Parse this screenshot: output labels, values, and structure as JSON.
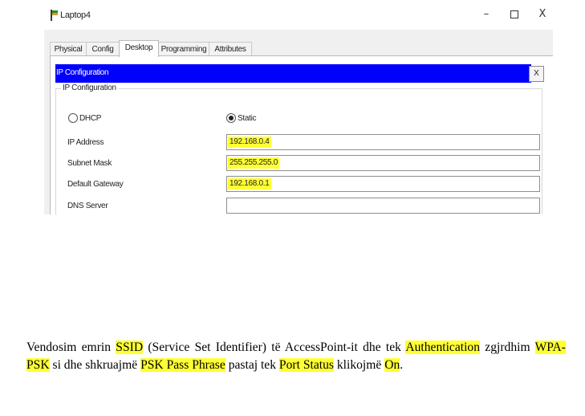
{
  "window": {
    "title": "Laptop4",
    "minimize_glyph": "–",
    "close_glyph": "X",
    "icon": "laptop-app-icon"
  },
  "tabs": [
    {
      "label": "Physical",
      "active": false
    },
    {
      "label": "Config",
      "active": false
    },
    {
      "label": "Desktop",
      "active": true
    },
    {
      "label": "Programming",
      "active": false
    },
    {
      "label": "Attributes",
      "active": false
    }
  ],
  "ip_config": {
    "bar_title": "IP Configuration",
    "close_label": "X",
    "group_label": "IP Configuration",
    "dhcp_label": "DHCP",
    "static_label": "Static",
    "mode": "Static",
    "ip_label": "IP Address",
    "ip_value": "192.168.0.4",
    "mask_label": "Subnet Mask",
    "mask_value": "255.255.255.0",
    "gateway_label": "Default Gateway",
    "gateway_value": "192.168.0.1",
    "dns_label": "DNS Server",
    "dns_value": ""
  },
  "paragraph": {
    "t1": "Vendosim emrin ",
    "h1": "SSID",
    "t2": " (Service Set Identifier) të AccessPoint-it dhe tek ",
    "h2": "Authentication",
    "t3": " zgjrdhim ",
    "h3": "WPA-PSK",
    "t4": " si dhe shkruajmë ",
    "h4": "PSK Pass Phrase",
    "t5": " pastaj tek ",
    "h5": "Port Status",
    "t6": " klikojmë ",
    "h6": "On",
    "t7": "."
  },
  "colors": {
    "bar_blue": "#0000ff",
    "highlight": "#ffff33"
  }
}
